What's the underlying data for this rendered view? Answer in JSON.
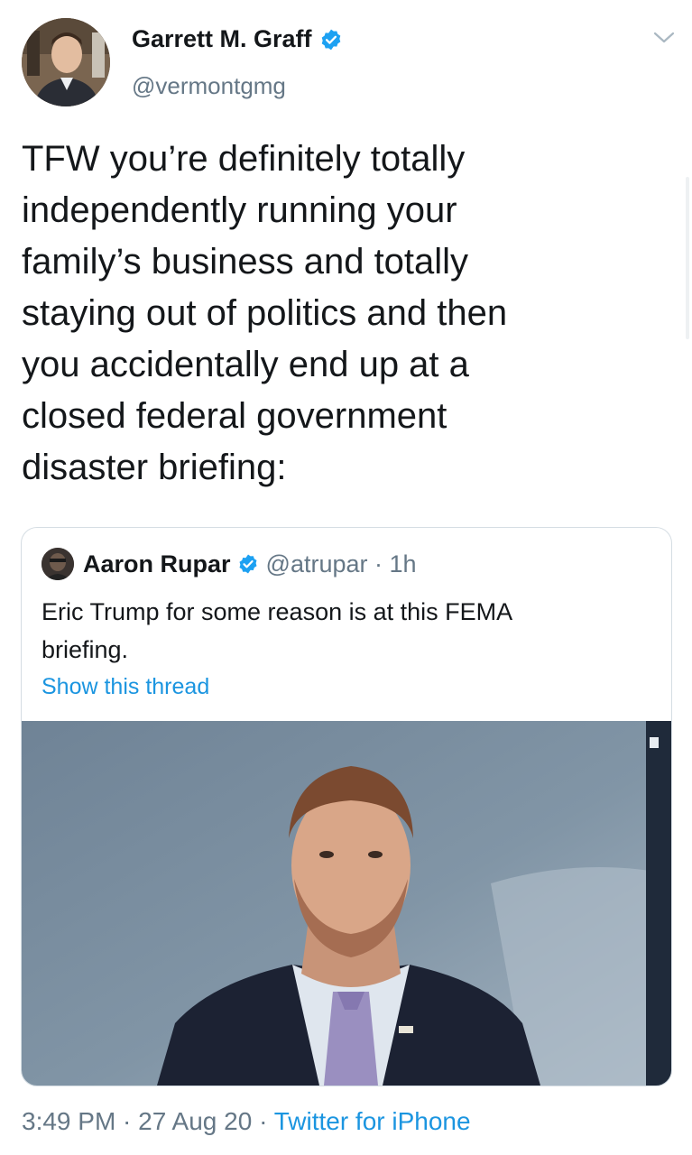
{
  "author": {
    "name": "Garrett M. Graff",
    "handle": "@vermontgmg"
  },
  "tweet": {
    "lines": [
      "TFW you’re definitely totally",
      "independently running your",
      "family’s business and totally",
      "staying out of politics and then",
      "you accidentally end up at a",
      "closed federal government",
      "disaster briefing:"
    ]
  },
  "quoted": {
    "name": "Aaron Rupar",
    "handle": "@atrupar",
    "sep": " · ",
    "time": "1h",
    "text_line1": "Eric Trump for some reason is at this FEMA",
    "text_line2": "briefing.",
    "thread_link": "Show this thread"
  },
  "footer": {
    "time": "3:49 PM",
    "sep1": " · ",
    "date": "27 Aug 20",
    "sep2": " · ",
    "source": "Twitter for iPhone"
  },
  "colors": {
    "link": "#1b95e0",
    "secondary": "#657786",
    "verified": "#1da1f2"
  }
}
